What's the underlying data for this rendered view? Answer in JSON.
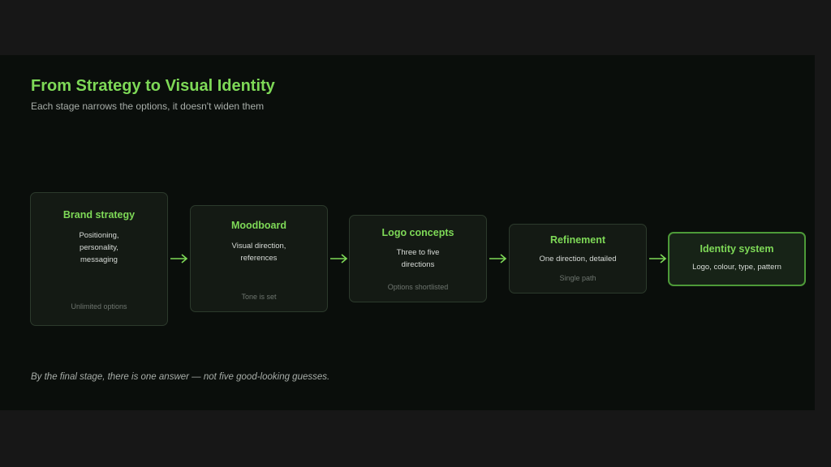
{
  "diagram": {
    "title": "From Strategy to Visual Identity",
    "subtitle": "Each stage narrows the options, it doesn't widen them",
    "stages": [
      {
        "title": "Brand strategy",
        "description": "Positioning, personality, messaging",
        "note": "Unlimited options"
      },
      {
        "title": "Moodboard",
        "description": "Visual direction, references",
        "note": "Tone is set"
      },
      {
        "title": "Logo concepts",
        "description": "Three to five directions",
        "note": "Options shortlisted"
      },
      {
        "title": "Refinement",
        "description": "One direction, detailed",
        "note": "Single path"
      },
      {
        "title": "Identity system",
        "description": "Logo, colour, type, pattern",
        "note": ""
      }
    ],
    "footer": "By the final stage, there is one answer — not five good-looking guesses."
  },
  "colors": {
    "accent": "#7ed957",
    "panel_background": "#0a0e0b",
    "stage_background": "#141a14",
    "stage_border": "#2c3a2c",
    "final_border": "#4d9a38"
  },
  "icons": {
    "connector": "arrow-right-icon"
  }
}
